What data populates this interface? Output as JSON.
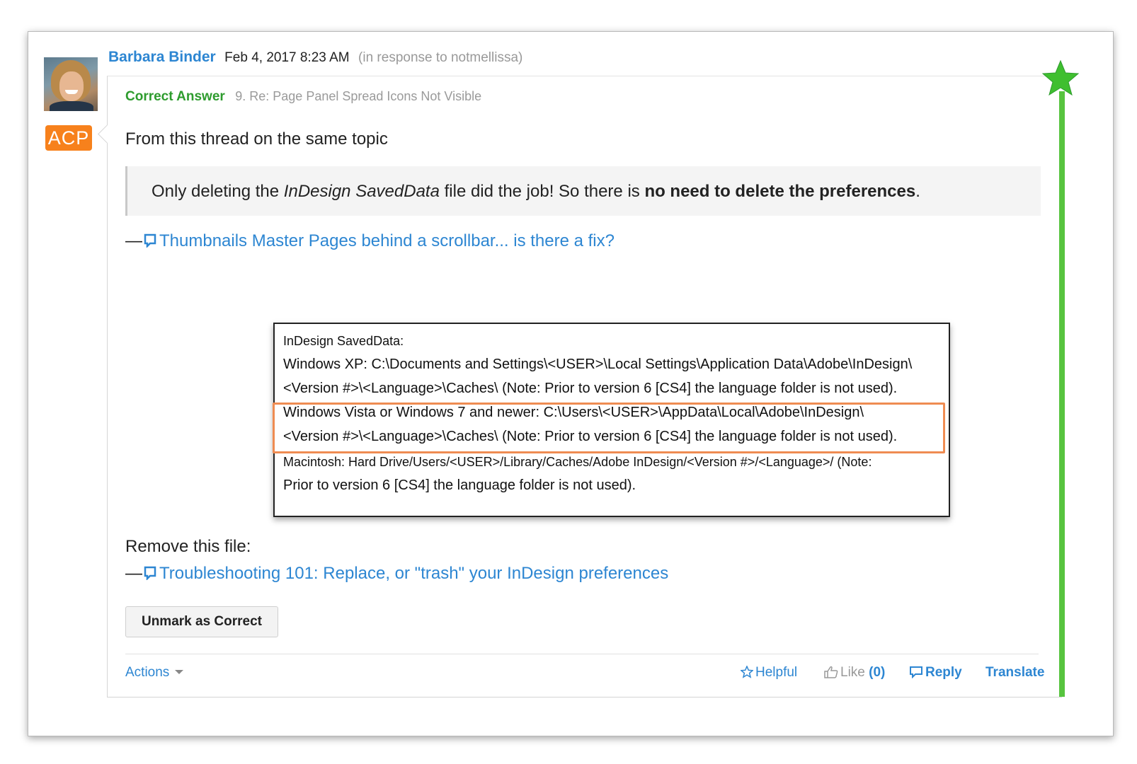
{
  "post": {
    "author": "Barbara Binder",
    "date": "Feb 4, 2017 8:23 AM",
    "in_response": "(in response to notmellissa)",
    "badge": "ACP",
    "correct_label": "Correct Answer",
    "subject": "9. Re: Page Panel Spread Icons Not Visible"
  },
  "body": {
    "intro": "From this thread on the same topic",
    "quote": {
      "part1": "Only deleting the ",
      "italic": "InDesign SavedData",
      "part2": " file did the job! So there is ",
      "bold": "no need to delete the preferences",
      "part3": "."
    },
    "link1": {
      "dash": "—",
      "text": "Thumbnails Master Pages behind a scrollbar... is there a fix?"
    },
    "remove_label": "Remove this file:",
    "link2": {
      "dash": "—",
      "text": "Troubleshooting 101: Replace, or \"trash\" your InDesign preferences"
    }
  },
  "screenshot": {
    "lines": [
      "InDesign SavedData:",
      "Windows XP: C:\\Documents and Settings\\<USER>\\Local Settings\\Application Data\\Adobe\\InDesign\\",
      "<Version #>\\<Language>\\Caches\\ (Note: Prior to version 6 [CS4] the language folder is not used).",
      "Windows Vista or Windows 7 and newer: C:\\Users\\<USER>\\AppData\\Local\\Adobe\\InDesign\\",
      "<Version #>\\<Language>\\Caches\\  (Note: Prior to version 6 [CS4] the language folder is not used).",
      "Macintosh: Hard Drive/Users/<USER>/Library/Caches/Adobe InDesign/<Version #>/<Language>/ (Note:",
      "Prior to version 6 [CS4] the language folder is not used)."
    ]
  },
  "buttons": {
    "unmark": "Unmark as Correct"
  },
  "footer": {
    "actions": "Actions",
    "helpful": "Helpful",
    "like": "Like",
    "like_count": "(0)",
    "reply": "Reply",
    "translate": "Translate"
  },
  "colors": {
    "link": "#2d86d2",
    "correct": "#2e9c2e",
    "badge": "#f7811c",
    "highlight": "#ef8c52",
    "green_bar": "#57c43f"
  }
}
